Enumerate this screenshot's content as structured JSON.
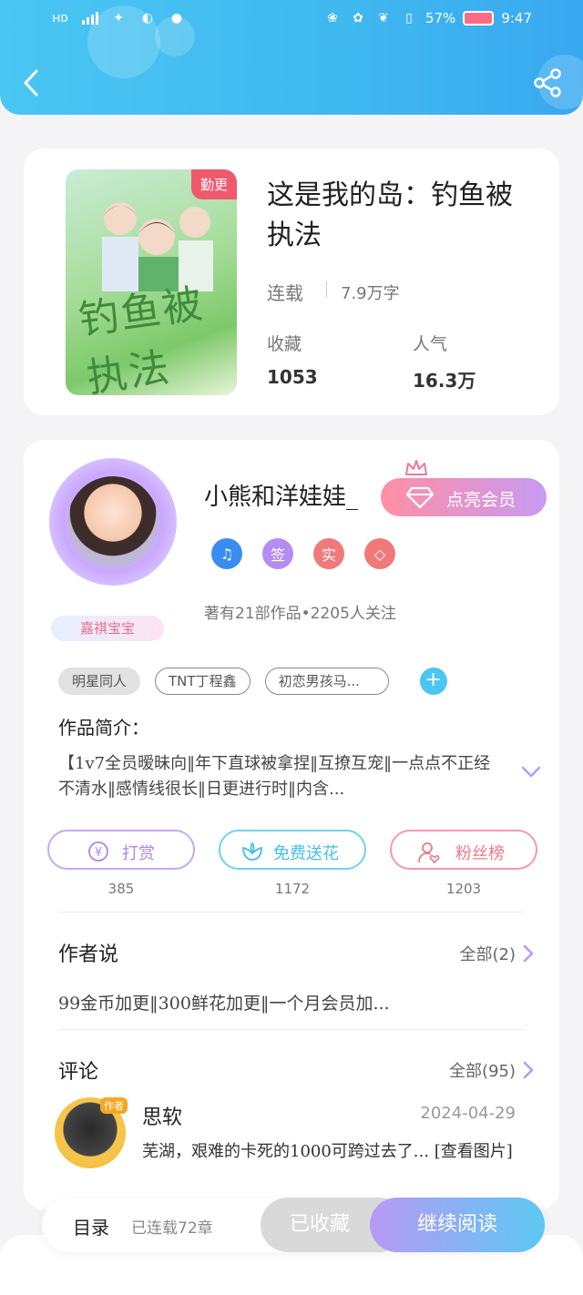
{
  "status_bar": {
    "battery": "57%",
    "time": "9:47"
  },
  "book": {
    "badge": "勤更",
    "title": "这是我的岛：钓鱼被执法",
    "status": "连载",
    "words": "7.9万字",
    "stats": [
      {
        "label": "收藏",
        "value": "1053"
      },
      {
        "label": "人气",
        "value": "16.3万"
      }
    ]
  },
  "author": {
    "name": "小熊和洋娃娃_",
    "fan_badge": "嘉祺宝宝",
    "vip_button": "点亮会员",
    "badges": [
      "签",
      "实"
    ],
    "meta": "著有21部作品•2205人关注",
    "tags": [
      "明星同人",
      "TNT丁程鑫",
      "初恋男孩马..."
    ],
    "intro_label": "作品简介：",
    "intro": "【1v7全员暧昧向‖年下直球被拿捏‖互撩互宠‖一点点不正经不清水‖感情线很长‖日更进行时‖内含..."
  },
  "actions": [
    {
      "label": "打赏",
      "count": "385"
    },
    {
      "label": "免费送花",
      "count": "1172"
    },
    {
      "label": "粉丝榜",
      "count": "1203"
    }
  ],
  "author_say": {
    "title": "作者说",
    "more": "全部(2)",
    "text": "99金币加更‖300鲜花加更‖一个月会员加..."
  },
  "comments": {
    "title": "评论",
    "more": "全部(95)",
    "item": {
      "tag": "作者",
      "name": "思软",
      "date": "2024-04-29",
      "text": "芜湖，艰难的卡死的1000可跨过去了... [查看图片]"
    }
  },
  "bottom": {
    "toc": "目录",
    "chapters": "已连载72章",
    "favorited": "已收藏",
    "continue": "继续阅读"
  },
  "colors": {
    "header": "#40b8f0",
    "accent_pink": "#ee5a6c",
    "accent_purple": "#b79af5",
    "accent_blue": "#4cc6f0"
  }
}
